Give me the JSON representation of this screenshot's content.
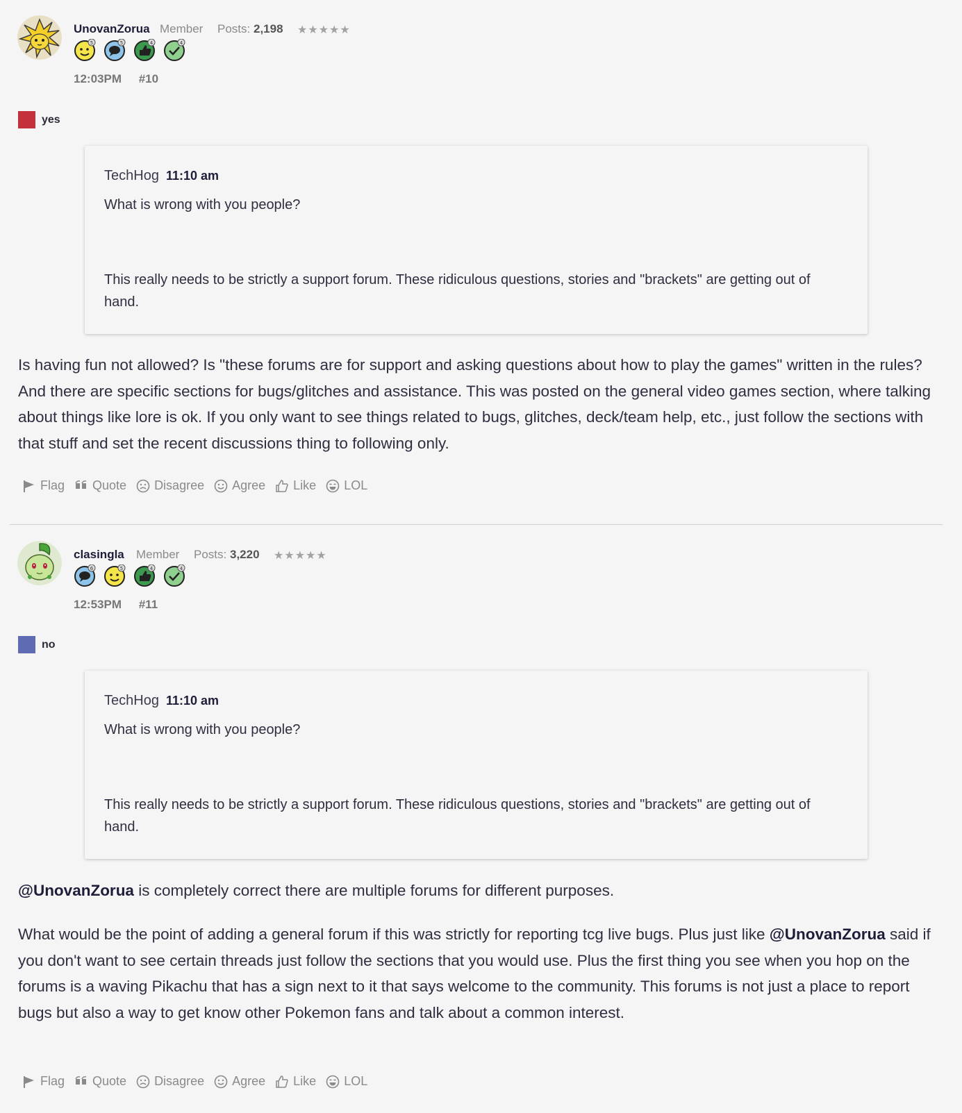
{
  "posts": [
    {
      "username": "UnovanZorua",
      "role": "Member",
      "posts_label": "Posts:",
      "posts_count": "2,198",
      "stars": "★★★★★",
      "badges": [
        {
          "icon": "smiley-badge-icon",
          "count": "5"
        },
        {
          "icon": "speech-bubble-badge-icon",
          "count": "5"
        },
        {
          "icon": "thumbs-up-badge-icon",
          "count": "4"
        },
        {
          "icon": "checkmark-badge-icon",
          "count": "4"
        }
      ],
      "time": "12:03PM",
      "number": "#10",
      "vote_label": "yes",
      "vote_color": "#c4303c",
      "quote": {
        "author": "TechHog",
        "time": "11:10 am",
        "line1": "What is wrong with you people?",
        "line2": "This really needs to be strictly a support forum. These ridiculous questions, stories and \"brackets\" are getting out of hand."
      },
      "body": "Is having fun not allowed? Is \"these forums are for support and asking questions about how to play the games\" written in the rules? And there are specific sections for bugs/glitches and assistance. This was posted on the general video games section, where talking about things like lore is ok. If you only want to see things related to bugs, glitches, deck/team help, etc., just follow the sections with that stuff and set the recent discussions thing to following only."
    },
    {
      "username": "clasingla",
      "role": "Member",
      "posts_label": "Posts:",
      "posts_count": "3,220",
      "stars": "★★★★★",
      "badges": [
        {
          "icon": "speech-bubble-badge-icon",
          "count": "6"
        },
        {
          "icon": "smiley-badge-icon",
          "count": "5"
        },
        {
          "icon": "thumbs-up-badge-icon",
          "count": "4"
        },
        {
          "icon": "checkmark-badge-icon",
          "count": "4"
        }
      ],
      "time": "12:53PM",
      "number": "#11",
      "vote_label": "no",
      "vote_color": "#5f6bb3",
      "quote": {
        "author": "TechHog",
        "time": "11:10 am",
        "line1": "What is wrong with you people?",
        "line2": "This really needs to be strictly a support forum. These ridiculous questions, stories and \"brackets\" are getting out of hand."
      },
      "mention": "@UnovanZorua",
      "body_p1_rest": " is completely correct there are multiple forums for different purposes.",
      "body_p2_start": "What would be the point of adding a general forum if this was strictly for reporting tcg live bugs. Plus just like ",
      "body_p2_rest": " said if you don't want to see certain threads just follow the sections that you would use. Plus the first thing you see when you hop on the forums is a waving Pikachu that has a sign next to it that says welcome to the community. This forums is not just a place to report bugs but also a way to get know other Pokemon fans and talk about a common interest."
    }
  ],
  "actions": {
    "flag": "Flag",
    "quote": "Quote",
    "disagree": "Disagree",
    "agree": "Agree",
    "like": "Like",
    "lol": "LOL"
  }
}
